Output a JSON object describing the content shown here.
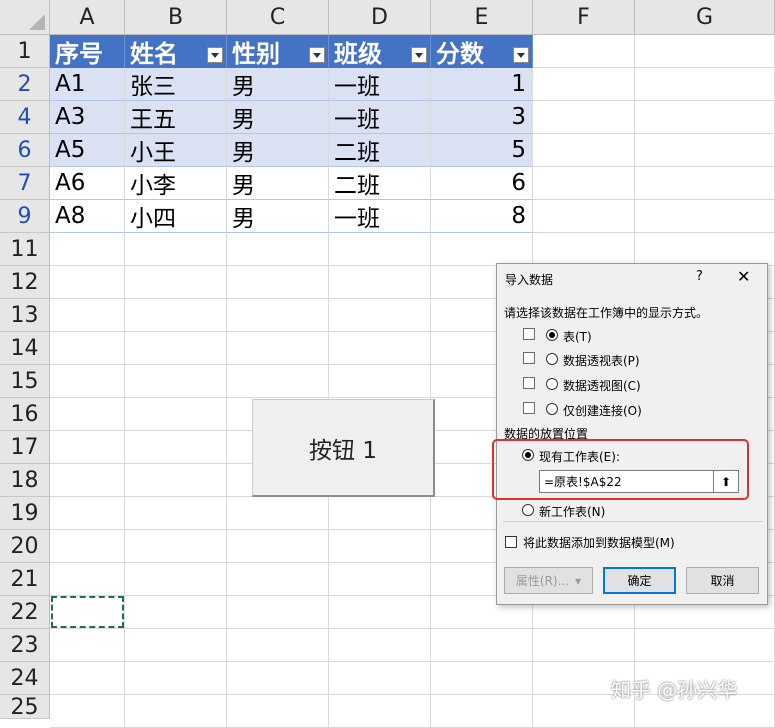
{
  "columns": [
    "A",
    "B",
    "C",
    "D",
    "E",
    "F",
    "G"
  ],
  "rows": [
    "1",
    "2",
    "4",
    "6",
    "7",
    "9",
    "11",
    "12",
    "13",
    "14",
    "15",
    "16",
    "17",
    "18",
    "19",
    "20",
    "21",
    "22",
    "23",
    "24",
    "25"
  ],
  "table": {
    "headers": [
      "序号",
      "姓名",
      "性别",
      "班级",
      "分数"
    ],
    "data": [
      [
        "A1",
        "张三",
        "男",
        "一班",
        "1"
      ],
      [
        "A3",
        "王五",
        "男",
        "一班",
        "3"
      ],
      [
        "A5",
        "小王",
        "男",
        "二班",
        "5"
      ],
      [
        "A6",
        "小李",
        "男",
        "二班",
        "6"
      ],
      [
        "A8",
        "小四",
        "男",
        "一班",
        "8"
      ]
    ]
  },
  "button_label": "按钮 1",
  "dialog": {
    "title": "导入数据",
    "help": "?",
    "close": "✕",
    "prompt": "请选择该数据在工作簿中的显示方式。",
    "view_options": [
      "表(T)",
      "数据透视表(P)",
      "数据透视图(C)",
      "仅创建连接(O)"
    ],
    "placement_label": "数据的放置位置",
    "existing_sheet": "现有工作表(E):",
    "ref_value": "=原表!$A$22",
    "ref_button": "⬆",
    "new_sheet": "新工作表(N)",
    "add_model": "将此数据添加到数据模型(M)",
    "properties": "属性(R)...",
    "properties_arrow": "▾",
    "ok": "确定",
    "cancel": "取消"
  },
  "watermark": "知乎 @孙兴华",
  "colors": {
    "header_blue": "#4472c4",
    "band": "#d9e1f2",
    "filtered_row": "#1f4db8",
    "highlight_red": "#e0302e"
  }
}
